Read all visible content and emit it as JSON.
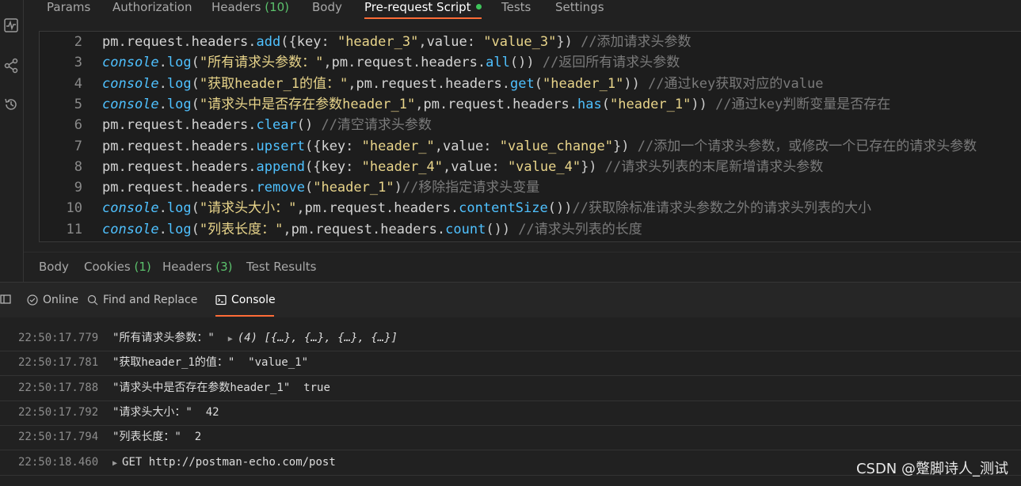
{
  "request_tabs": [
    {
      "label": "Params"
    },
    {
      "label": "Authorization"
    },
    {
      "label": "Headers",
      "count": "(10)"
    },
    {
      "label": "Body"
    },
    {
      "label": "Pre-request Script"
    },
    {
      "label": "Tests"
    },
    {
      "label": "Settings"
    }
  ],
  "rail_icons": [
    "activity-icon",
    "share-icon",
    "history-icon"
  ],
  "code_lines": [
    {
      "n": "2",
      "tokens": [
        [
          "t-id",
          "pm"
        ],
        [
          "t-pun",
          "."
        ],
        [
          "t-id",
          "request"
        ],
        [
          "t-pun",
          "."
        ],
        [
          "t-id",
          "headers"
        ],
        [
          "t-pun",
          "."
        ],
        [
          "t-fn",
          "add"
        ],
        [
          "t-pun",
          "({"
        ],
        [
          "t-id",
          "key"
        ],
        [
          "t-pun",
          ": "
        ],
        [
          "t-str",
          "\"header_3\""
        ],
        [
          "t-pun",
          ","
        ],
        [
          "t-id",
          "value"
        ],
        [
          "t-pun",
          ": "
        ],
        [
          "t-str",
          "\"value_3\""
        ],
        [
          "t-pun",
          "}) "
        ],
        [
          "t-cm",
          "//添加请求头参数"
        ]
      ]
    },
    {
      "n": "3",
      "tokens": [
        [
          "t-con",
          "console"
        ],
        [
          "t-pun",
          "."
        ],
        [
          "t-fn",
          "log"
        ],
        [
          "t-pun",
          "("
        ],
        [
          "t-str",
          "\"所有请求头参数：\""
        ],
        [
          "t-pun",
          ","
        ],
        [
          "t-id",
          "pm"
        ],
        [
          "t-pun",
          "."
        ],
        [
          "t-id",
          "request"
        ],
        [
          "t-pun",
          "."
        ],
        [
          "t-id",
          "headers"
        ],
        [
          "t-pun",
          "."
        ],
        [
          "t-fn",
          "all"
        ],
        [
          "t-pun",
          "()) "
        ],
        [
          "t-cm",
          "//返回所有请求头参数"
        ]
      ]
    },
    {
      "n": "4",
      "tokens": [
        [
          "t-con",
          "console"
        ],
        [
          "t-pun",
          "."
        ],
        [
          "t-fn",
          "log"
        ],
        [
          "t-pun",
          "("
        ],
        [
          "t-str",
          "\"获取header_1的值：\""
        ],
        [
          "t-pun",
          ","
        ],
        [
          "t-id",
          "pm"
        ],
        [
          "t-pun",
          "."
        ],
        [
          "t-id",
          "request"
        ],
        [
          "t-pun",
          "."
        ],
        [
          "t-id",
          "headers"
        ],
        [
          "t-pun",
          "."
        ],
        [
          "t-fn",
          "get"
        ],
        [
          "t-pun",
          "("
        ],
        [
          "t-str",
          "\"header_1\""
        ],
        [
          "t-pun",
          "))"
        ],
        [
          "t-cm",
          " //通过key获取对应的value"
        ]
      ]
    },
    {
      "n": "5",
      "tokens": [
        [
          "t-con",
          "console"
        ],
        [
          "t-pun",
          "."
        ],
        [
          "t-fn",
          "log"
        ],
        [
          "t-pun",
          "("
        ],
        [
          "t-str",
          "\"请求头中是否存在参数header_1\""
        ],
        [
          "t-pun",
          ","
        ],
        [
          "t-id",
          "pm"
        ],
        [
          "t-pun",
          "."
        ],
        [
          "t-id",
          "request"
        ],
        [
          "t-pun",
          "."
        ],
        [
          "t-id",
          "headers"
        ],
        [
          "t-pun",
          "."
        ],
        [
          "t-fn",
          "has"
        ],
        [
          "t-pun",
          "("
        ],
        [
          "t-str",
          "\"header_1\""
        ],
        [
          "t-pun",
          "))"
        ],
        [
          "t-cm",
          " //通过key判断变量是否存在"
        ]
      ]
    },
    {
      "n": "6",
      "tokens": [
        [
          "t-id",
          "pm"
        ],
        [
          "t-pun",
          "."
        ],
        [
          "t-id",
          "request"
        ],
        [
          "t-pun",
          "."
        ],
        [
          "t-id",
          "headers"
        ],
        [
          "t-pun",
          "."
        ],
        [
          "t-fn",
          "clear"
        ],
        [
          "t-pun",
          "() "
        ],
        [
          "t-cm",
          "//清空请求头参数"
        ]
      ]
    },
    {
      "n": "7",
      "tokens": [
        [
          "t-id",
          "pm"
        ],
        [
          "t-pun",
          "."
        ],
        [
          "t-id",
          "request"
        ],
        [
          "t-pun",
          "."
        ],
        [
          "t-id",
          "headers"
        ],
        [
          "t-pun",
          "."
        ],
        [
          "t-fn",
          "upsert"
        ],
        [
          "t-pun",
          "({"
        ],
        [
          "t-id",
          "key"
        ],
        [
          "t-pun",
          ": "
        ],
        [
          "t-str",
          "\"header_\""
        ],
        [
          "t-pun",
          ","
        ],
        [
          "t-id",
          "value"
        ],
        [
          "t-pun",
          ": "
        ],
        [
          "t-str",
          "\"value_change\""
        ],
        [
          "t-pun",
          "}) "
        ],
        [
          "t-cm",
          "//添加一个请求头参数，或修改一个已存在的请求头参数"
        ]
      ]
    },
    {
      "n": "8",
      "tokens": [
        [
          "t-id",
          "pm"
        ],
        [
          "t-pun",
          "."
        ],
        [
          "t-id",
          "request"
        ],
        [
          "t-pun",
          "."
        ],
        [
          "t-id",
          "headers"
        ],
        [
          "t-pun",
          "."
        ],
        [
          "t-fn",
          "append"
        ],
        [
          "t-pun",
          "({"
        ],
        [
          "t-id",
          "key"
        ],
        [
          "t-pun",
          ": "
        ],
        [
          "t-str",
          "\"header_4\""
        ],
        [
          "t-pun",
          ","
        ],
        [
          "t-id",
          "value"
        ],
        [
          "t-pun",
          ": "
        ],
        [
          "t-str",
          "\"value_4\""
        ],
        [
          "t-pun",
          "}) "
        ],
        [
          "t-cm",
          "//请求头列表的末尾新增请求头参数"
        ]
      ]
    },
    {
      "n": "9",
      "tokens": [
        [
          "t-id",
          "pm"
        ],
        [
          "t-pun",
          "."
        ],
        [
          "t-id",
          "request"
        ],
        [
          "t-pun",
          "."
        ],
        [
          "t-id",
          "headers"
        ],
        [
          "t-pun",
          "."
        ],
        [
          "t-fn",
          "remove"
        ],
        [
          "t-pun",
          "("
        ],
        [
          "t-str",
          "\"header_1\""
        ],
        [
          "t-pun",
          ")"
        ],
        [
          "t-cm",
          "//移除指定请求头变量"
        ]
      ]
    },
    {
      "n": "10",
      "tokens": [
        [
          "t-con",
          "console"
        ],
        [
          "t-pun",
          "."
        ],
        [
          "t-fn",
          "log"
        ],
        [
          "t-pun",
          "("
        ],
        [
          "t-str",
          "\"请求头大小：\""
        ],
        [
          "t-pun",
          ","
        ],
        [
          "t-id",
          "pm"
        ],
        [
          "t-pun",
          "."
        ],
        [
          "t-id",
          "request"
        ],
        [
          "t-pun",
          "."
        ],
        [
          "t-id",
          "headers"
        ],
        [
          "t-pun",
          "."
        ],
        [
          "t-fn",
          "contentSize"
        ],
        [
          "t-pun",
          "())"
        ],
        [
          "t-cm",
          "//获取除标准请求头参数之外的请求头列表的大小"
        ]
      ]
    },
    {
      "n": "11",
      "tokens": [
        [
          "t-con",
          "console"
        ],
        [
          "t-pun",
          "."
        ],
        [
          "t-fn",
          "log"
        ],
        [
          "t-pun",
          "("
        ],
        [
          "t-str",
          "\"列表长度：\""
        ],
        [
          "t-pun",
          ","
        ],
        [
          "t-id",
          "pm"
        ],
        [
          "t-pun",
          "."
        ],
        [
          "t-id",
          "request"
        ],
        [
          "t-pun",
          "."
        ],
        [
          "t-id",
          "headers"
        ],
        [
          "t-pun",
          "."
        ],
        [
          "t-fn",
          "count"
        ],
        [
          "t-pun",
          "()) "
        ],
        [
          "t-cm",
          "//请求头列表的长度"
        ]
      ]
    }
  ],
  "response_tabs": [
    {
      "label": "Body"
    },
    {
      "label": "Cookies",
      "count": "(1)"
    },
    {
      "label": "Headers",
      "count": "(3)"
    },
    {
      "label": "Test Results"
    }
  ],
  "statusbar": {
    "online": "Online",
    "find": "Find and Replace",
    "console": "Console"
  },
  "console_logs": [
    {
      "ts": "22:50:17.779",
      "msg": "\"所有请求头参数：\"",
      "expand": true,
      "value": "(4) [{…}, {…}, {…}, {…}]"
    },
    {
      "ts": "22:50:17.781",
      "msg": "\"获取header_1的值：\"",
      "value": "\"value_1\""
    },
    {
      "ts": "22:50:17.788",
      "msg": "\"请求头中是否存在参数header_1\"",
      "value": "true"
    },
    {
      "ts": "22:50:17.792",
      "msg": "\"请求头大小：\"",
      "value": "42"
    },
    {
      "ts": "22:50:17.794",
      "msg": "\"列表长度：\"",
      "value": "2"
    },
    {
      "ts": "22:50:18.460",
      "msg": "GET http://postman-echo.com/post",
      "request": true
    }
  ],
  "watermark": "CSDN @蹩脚诗人_测试"
}
